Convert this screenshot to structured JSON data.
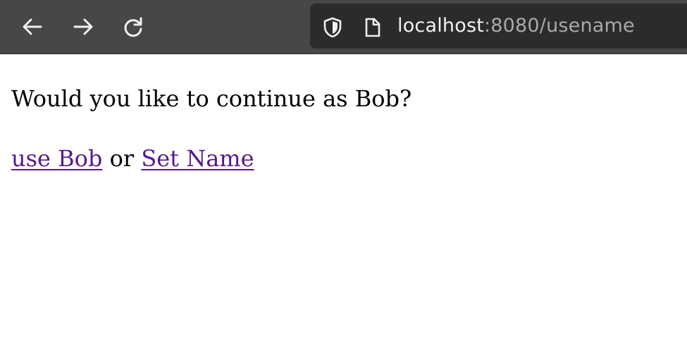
{
  "browser": {
    "back_icon": "arrow-left-icon",
    "forward_icon": "arrow-right-icon",
    "reload_icon": "reload-icon",
    "security_icon": "shield-icon",
    "page_icon": "page-icon",
    "url": {
      "host": "localhost",
      "rest": ":8080/usename"
    },
    "colors": {
      "toolbar": "#474747",
      "urlbar": "#2b2b2b"
    }
  },
  "page": {
    "question": "Would you like to continue as Bob?",
    "use_link": "use Bob",
    "separator": "or",
    "set_name_link": "Set Name",
    "colors": {
      "link": "#551a8b",
      "text": "#000000"
    }
  }
}
